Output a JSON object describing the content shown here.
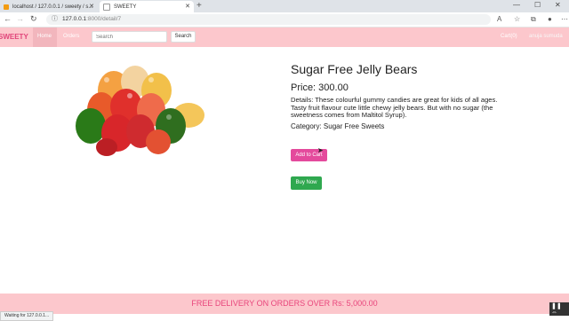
{
  "browser": {
    "tabs": [
      {
        "label": "localhost / 127.0.0.1 / sweety / s..."
      },
      {
        "label": "SWEETY"
      }
    ],
    "new_tab": "+",
    "url_host": "127.0.0.1",
    "url_path": ":8000/detail/7",
    "status_text": "Waiting for 127.0.0.1..."
  },
  "navbar": {
    "brand": "SWEETY",
    "home": "Home",
    "orders": "Orders",
    "search_placeholder": "Search",
    "search_button": "Search",
    "cart": "Cart(0)",
    "user": "anuja sumuda"
  },
  "product": {
    "image_alt": "gummy-bears",
    "title": "Sugar Free Jelly Bears",
    "price": "Price: 300.00",
    "details": "Details: These colourful gummy candies are great for kids of all ages. Tasty fruit flavour cute little chewy jelly bears. But with no sugar (the sweetness comes from Maltitol Syrup).",
    "category": "Category: Sugar Free Sweets",
    "add_to_cart": "Add to Cart",
    "buy_now": "Buy Now"
  },
  "footer": {
    "text": "FREE DELIVERY ON ORDERS OVER Rs: 5,000.00"
  },
  "colors": {
    "navbar": "#fcc7cc",
    "brand": "#e0457a",
    "add_to_cart": "#e44a9c",
    "buy_now": "#2fa84f",
    "footer_text": "#e8457c"
  }
}
